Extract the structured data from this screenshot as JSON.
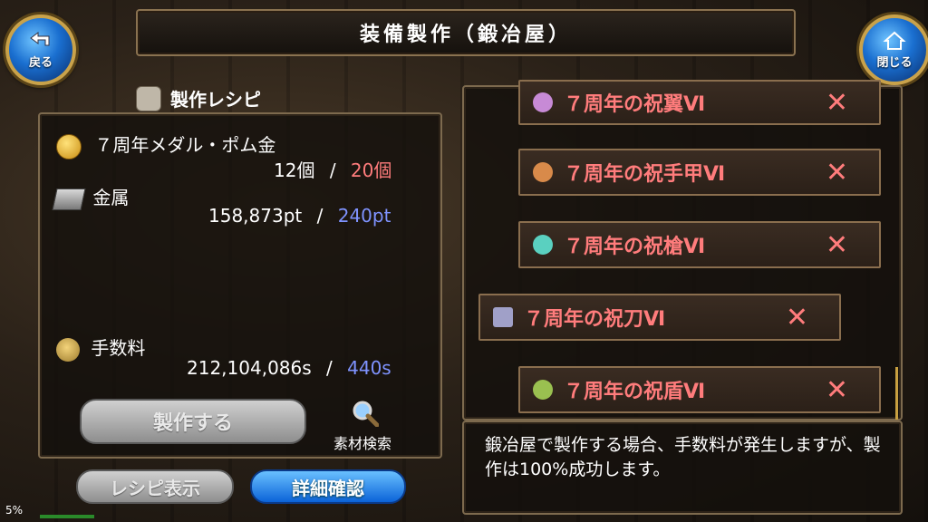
{
  "header": {
    "title": "装備製作（鍛冶屋）",
    "back_label": "戻る",
    "close_label": "閉じる"
  },
  "recipe": {
    "heading": "製作レシピ",
    "medal_name": "７周年メダル・ポム金",
    "medal_have": "12個",
    "medal_sep": "/",
    "medal_need": "20個",
    "metal_name": "金属",
    "metal_have": "158,873pt",
    "metal_sep": "/",
    "metal_need": "240pt",
    "fee_name": "手数料",
    "fee_have": "212,104,086s",
    "fee_sep": "/",
    "fee_need": "440s"
  },
  "buttons": {
    "craft": "製作する",
    "search": "素材検索",
    "recipe_view": "レシピ表示",
    "detail": "詳細確認"
  },
  "items": [
    {
      "name": "７周年の祝翼Ⅵ",
      "icon_color": "#c78ad6"
    },
    {
      "name": "７周年の祝手甲Ⅵ",
      "icon_color": "#d88a4a"
    },
    {
      "name": "７周年の祝槍Ⅵ",
      "icon_color": "#5ad0c0"
    },
    {
      "name": "７周年の祝刀Ⅵ",
      "icon_color": "#a0a0c8"
    },
    {
      "name": "７周年の祝盾Ⅵ",
      "icon_color": "#9ac050"
    }
  ],
  "item_mark": "✕",
  "notice": "鍛冶屋で製作する場合、手数料が発生しますが、製作は100%成功します。",
  "status": {
    "percent": "5%"
  },
  "colors": {
    "need_red": "#ff7c7c",
    "need_blue": "#7f93ff",
    "button_blue": "#0b63d8"
  }
}
